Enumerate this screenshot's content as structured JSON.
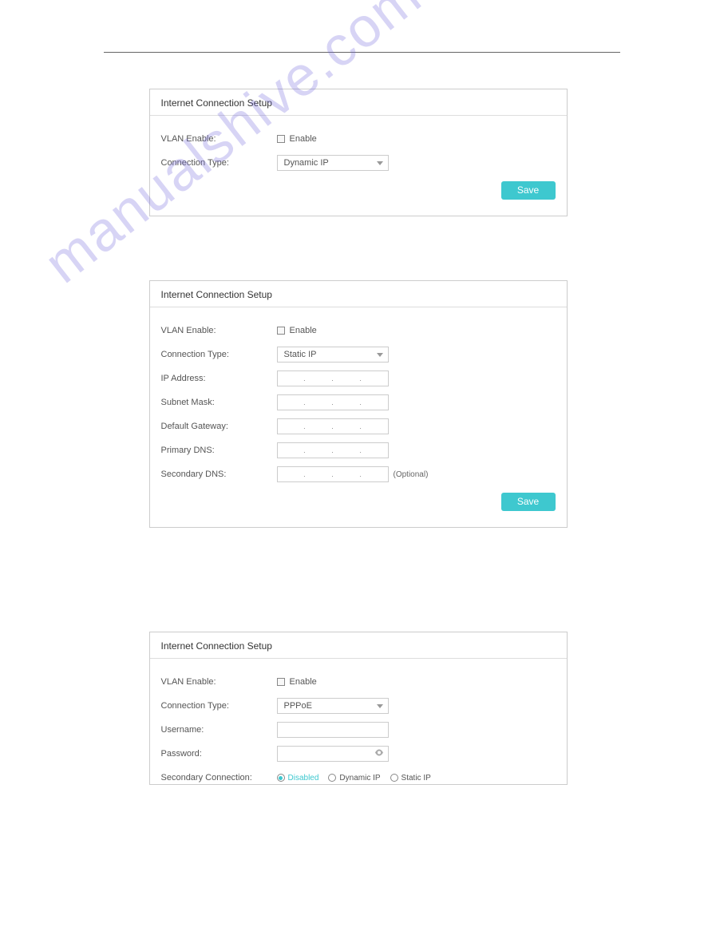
{
  "watermark": "manualshive.com",
  "common": {
    "panel_title": "Internet Connection Setup",
    "vlan_label": "VLAN Enable:",
    "enable_label": "Enable",
    "conn_type_label": "Connection Type:",
    "save_label": "Save"
  },
  "panel1": {
    "conn_type_value": "Dynamic IP"
  },
  "panel2": {
    "conn_type_value": "Static IP",
    "ip_label": "IP Address:",
    "subnet_label": "Subnet Mask:",
    "gateway_label": "Default Gateway:",
    "pdns_label": "Primary DNS:",
    "sdns_label": "Secondary DNS:",
    "optional_label": "(Optional)"
  },
  "panel3": {
    "conn_type_value": "PPPoE",
    "username_label": "Username:",
    "password_label": "Password:",
    "secondary_label": "Secondary Connection:",
    "radios": {
      "disabled": "Disabled",
      "dynamic": "Dynamic IP",
      "static": "Static IP"
    }
  }
}
